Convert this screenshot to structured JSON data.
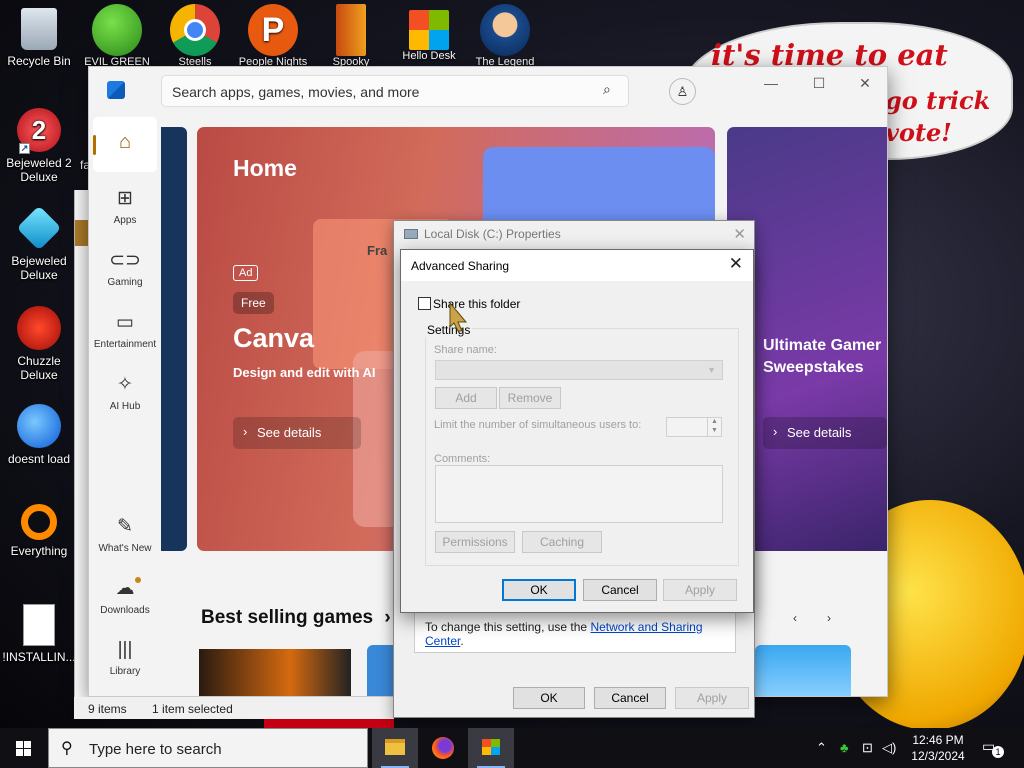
{
  "desktop": {
    "left_icons": [
      {
        "label": "Recycle Bin",
        "icon": "recycle-bin-icon"
      },
      {
        "label": "Bejeweled 2 Deluxe",
        "icon": "bejeweled2-icon"
      },
      {
        "label": "Bejeweled Deluxe",
        "icon": "bejeweled-icon"
      },
      {
        "label": "Chuzzle Deluxe",
        "icon": "chuzzle-icon"
      },
      {
        "label": "doesnt load",
        "icon": "thunderbird-icon"
      },
      {
        "label": "Everything",
        "icon": "everything-icon"
      },
      {
        "label": "!INSTALLIN...",
        "icon": "text-file-icon"
      }
    ],
    "top_icons": [
      {
        "label": "EVIL GREEN",
        "icon": "people-icon"
      },
      {
        "label": "Steells",
        "icon": "chrome-icon"
      },
      {
        "label": "People Nights",
        "icon": "p-app-icon"
      },
      {
        "label": "Spooky",
        "icon": "door-icon"
      },
      {
        "label": "Hello Desk",
        "icon": "windows-logo-icon"
      },
      {
        "label": "The Legend",
        "icon": "character-icon"
      }
    ],
    "speech": {
      "line1": "it's time to eat shit",
      "line2": "go trick",
      "line3": "vote!"
    },
    "partial_label": "fa"
  },
  "store": {
    "search_placeholder": "Search apps, games, movies, and more",
    "nav": [
      {
        "label": "",
        "icon": "home-icon",
        "active": true
      },
      {
        "label": "Apps",
        "icon": "apps-icon"
      },
      {
        "label": "Gaming",
        "icon": "gamepad-icon"
      },
      {
        "label": "Entertainment",
        "icon": "film-icon"
      },
      {
        "label": "AI Hub",
        "icon": "sparkle-icon"
      },
      {
        "label": "What's New",
        "icon": "whats-new-icon"
      },
      {
        "label": "Downloads",
        "icon": "downloads-icon"
      },
      {
        "label": "Library",
        "icon": "library-icon"
      }
    ],
    "hero": {
      "page_title": "Home",
      "ad_badge": "Ad",
      "price_badge": "Free",
      "app_name": "Canva",
      "description": "Design and edit with AI",
      "details_button": "See details",
      "card_partial": "Fra"
    },
    "hero2": {
      "title": "Ultimate Gamer Sweepstakes",
      "details_button": "See details"
    },
    "section_title": "Best selling games",
    "section_chevron": "›"
  },
  "explorer": {
    "status_items": "9 items",
    "status_selected": "1 item selected"
  },
  "properties": {
    "title": "Local Disk (C:) Properties",
    "info_text": "To change this setting, use the ",
    "info_link": "Network and Sharing Center",
    "info_end": ".",
    "ok": "OK",
    "cancel": "Cancel",
    "apply": "Apply"
  },
  "advanced_sharing": {
    "title": "Advanced Sharing",
    "share_checkbox_label": "Share this folder",
    "share_checked": false,
    "settings_group": "Settings",
    "share_name_label": "Share name:",
    "share_name_value": "",
    "add": "Add",
    "remove": "Remove",
    "limit_label": "Limit the number of simultaneous users to:",
    "limit_value": "",
    "comments_label": "Comments:",
    "comments_value": "",
    "permissions": "Permissions",
    "caching": "Caching",
    "ok": "OK",
    "cancel": "Cancel",
    "apply": "Apply"
  },
  "taskbar": {
    "search_placeholder": "Type here to search",
    "apps": [
      "file-explorer-icon",
      "firefox-icon",
      "store-icon"
    ],
    "time": "12:46 PM",
    "date": "12/3/2024",
    "notification_count": "1"
  },
  "colors": {
    "accent": "#0078d7",
    "store_nav_active": "#9a5a00",
    "link": "#0044cc"
  }
}
